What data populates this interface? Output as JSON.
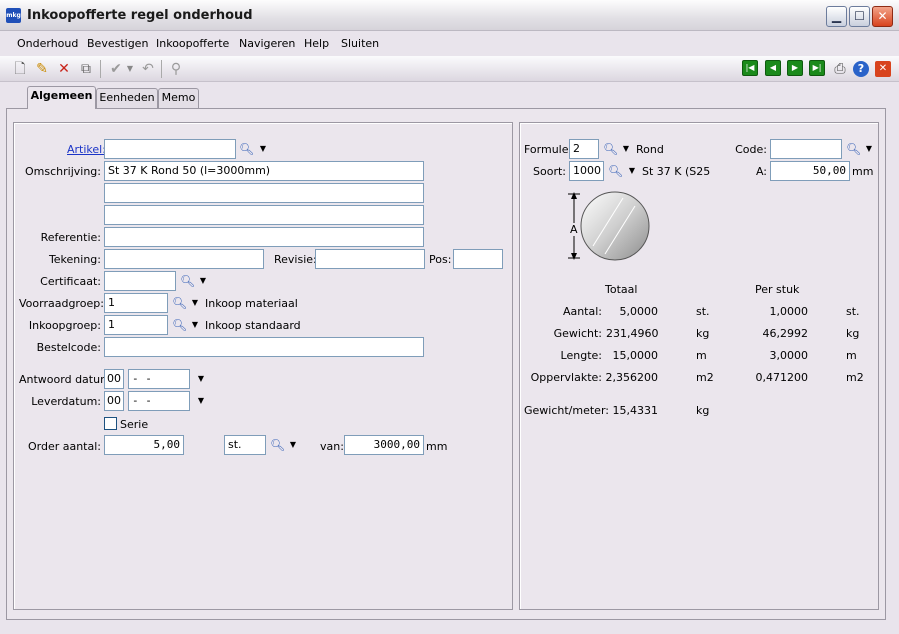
{
  "window": {
    "app_icon": "mkg",
    "title": "Inkoopofferte regel onderhoud",
    "controls": [
      "minimize-icon",
      "maximize-icon",
      "close-icon"
    ]
  },
  "menu": [
    "Onderhoud",
    "Bevestigen",
    "Inkoopofferte",
    "Navigeren",
    "Help",
    "Sluiten"
  ],
  "toolbar": {
    "left_icons": [
      "new-document-icon",
      "edit-pencil-icon",
      "delete-x-icon",
      "copy-icon",
      "confirm-check-icon",
      "undo-icon",
      "link-icon"
    ],
    "right_icons": [
      "first-record-icon",
      "previous-record-icon",
      "next-record-icon",
      "last-record-icon",
      "print-icon",
      "help-icon",
      "close-icon"
    ]
  },
  "tabs": [
    "Algemeen",
    "Eenheden",
    "Memo"
  ],
  "left": {
    "artikel_label": "Artikel:",
    "artikel_value": "",
    "omschrijving_label": "Omschrijving:",
    "omschrijving_lines": [
      "St 37 K Rond 50 (l=3000mm)",
      "",
      ""
    ],
    "referentie_label": "Referentie:",
    "referentie_value": "",
    "tekening_label": "Tekening:",
    "tekening_value": "",
    "revisie_label": "Revisie:",
    "revisie_value": "",
    "pos_label": "Pos:",
    "pos_value": "",
    "certificaat_label": "Certificaat:",
    "certificaat_value": "",
    "voorraadgroep_label": "Voorraadgroep:",
    "voorraadgroep_value": "1",
    "voorraadgroep_desc": "Inkoop materiaal",
    "inkoopgroep_label": "Inkoopgroep:",
    "inkoopgroep_value": "1",
    "inkoopgroep_desc": "Inkoop standaard",
    "bestelcode_label": "Bestelcode:",
    "bestelcode_value": "",
    "antwoord_label": "Antwoord datum:",
    "antwoord_week": "00",
    "antwoord_date": " - -",
    "lever_label": "Leverdatum:",
    "lever_week": "00",
    "lever_date": " - -",
    "serie_label": "Serie",
    "serie_checked": false,
    "order_label": "Order aantal:",
    "order_value": "5,00",
    "unit_value": "st.",
    "van_label": "van:",
    "van_value": "3000,00",
    "van_unit": "mm"
  },
  "right": {
    "formule_label": "Formule:",
    "formule_value": "2",
    "formule_desc": "Rond",
    "code_label": "Code:",
    "code_value": "",
    "soort_label": "Soort:",
    "soort_value": "1000",
    "soort_desc": "St 37 K (S25",
    "a_label": "A:",
    "a_value": "50,00",
    "a_unit": "mm",
    "diagram_label": "A",
    "col_totaal": "Totaal",
    "col_per_stuk": "Per stuk",
    "rows": [
      {
        "label": "Aantal:",
        "total": "5,0000",
        "unit": "st.",
        "per": "1,0000",
        "per_unit": "st."
      },
      {
        "label": "Gewicht:",
        "total": "231,4960",
        "unit": "kg",
        "per": "46,2992",
        "per_unit": "kg"
      },
      {
        "label": "Lengte:",
        "total": "15,0000",
        "unit": "m",
        "per": "3,0000",
        "per_unit": "m"
      },
      {
        "label": "Oppervlakte:",
        "total": "2,356200",
        "unit": "m2",
        "per": "0,471200",
        "per_unit": "m2"
      }
    ],
    "gpm_label": "Gewicht/meter:",
    "gpm_value": "15,4331",
    "gpm_unit": "kg"
  }
}
